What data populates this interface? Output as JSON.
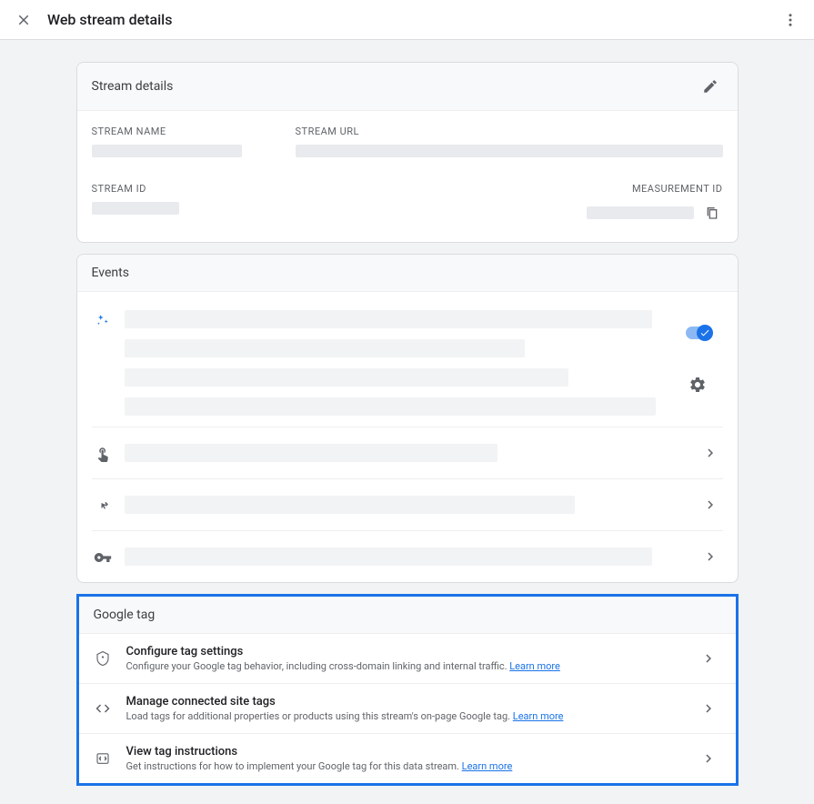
{
  "header": {
    "title": "Web stream details"
  },
  "stream_details": {
    "title": "Stream details",
    "stream_name_label": "STREAM NAME",
    "stream_url_label": "STREAM URL",
    "stream_id_label": "STREAM ID",
    "measurement_id_label": "MEASUREMENT ID"
  },
  "events": {
    "title": "Events"
  },
  "gtag": {
    "title": "Google tag",
    "rows": [
      {
        "title": "Configure tag settings",
        "desc": "Configure your Google tag behavior, including cross-domain linking and internal traffic. ",
        "link": "Learn more"
      },
      {
        "title": "Manage connected site tags",
        "desc": "Load tags for additional properties or products using this stream's on-page Google tag. ",
        "link": "Learn more"
      },
      {
        "title": "View tag instructions",
        "desc": "Get instructions for how to implement your Google tag for this data stream. ",
        "link": "Learn more"
      }
    ]
  }
}
